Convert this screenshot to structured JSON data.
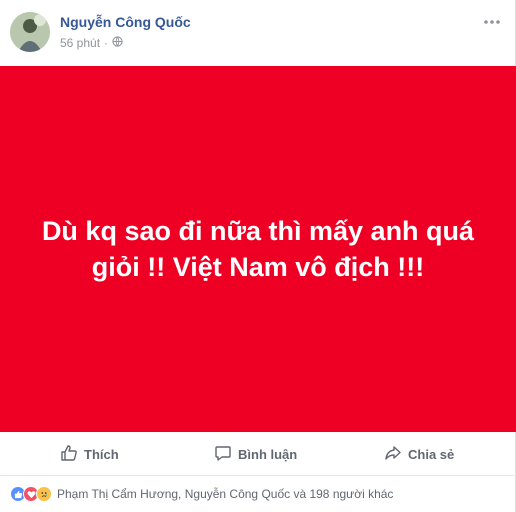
{
  "post": {
    "author": "Nguyễn Công Quốc",
    "time": "56 phút",
    "privacy_icon": "globe-icon",
    "more_icon": "more-horizontal-icon",
    "banner_text": "Dù kq sao đi nữa thì mấy anh quá giỏi !! Việt Nam vô địch !!!",
    "banner_color": "#ee0025"
  },
  "actions": {
    "like_label": "Thích",
    "comment_label": "Bình luận",
    "share_label": "Chia sẻ"
  },
  "reactions": {
    "icons": [
      "like-reaction-icon",
      "love-reaction-icon",
      "sad-reaction-icon"
    ],
    "summary": "Phạm Thị Cẩm Hương, Nguyễn Công Quốc và 198 người khác"
  },
  "colors": {
    "author_link": "#365899",
    "like_blue": "#5890ff",
    "love_red": "#f25268",
    "sad_yellow": "#f7c14a"
  }
}
